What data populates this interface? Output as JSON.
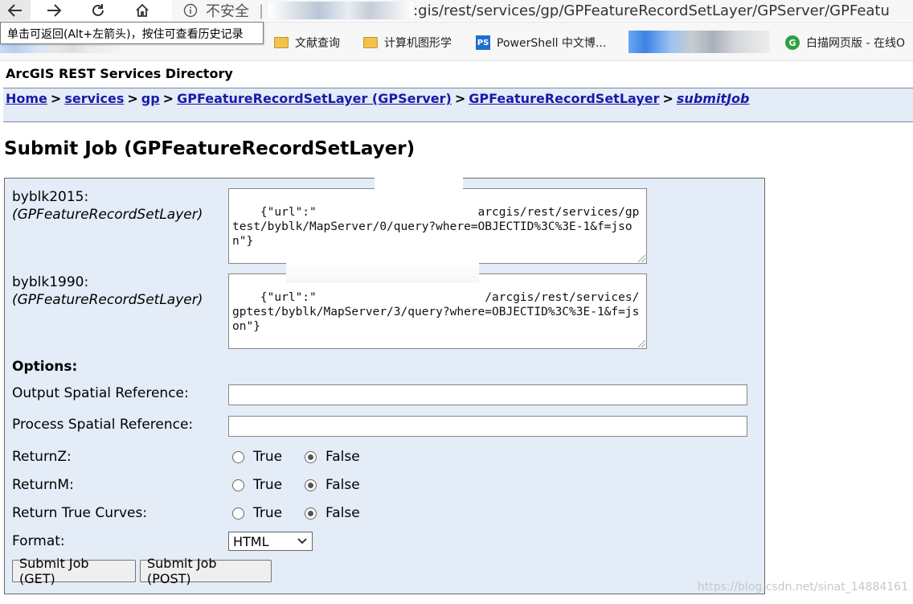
{
  "browser": {
    "insecure_label": "不安全",
    "address_separator": "|",
    "url": ":gis/rest/services/gp/GPFeatureRecordSetLayer/GPServer/GPFeatu",
    "tooltip": "单击可返回(Alt+左箭头)，按住可查看历史记录",
    "bookmarks": [
      {
        "label": "文献查询",
        "icon": "folder-icon"
      },
      {
        "label": "计算机图形学",
        "icon": "folder-icon"
      },
      {
        "label": "PowerShell 中文博...",
        "icon": "powershell-icon"
      },
      {
        "label": "白描网页版 - 在线O",
        "icon": "baimiao-icon"
      }
    ],
    "ps_icon_text": "PS",
    "baimiao_icon_text": "G"
  },
  "page": {
    "directory_title": "ArcGIS REST Services Directory",
    "breadcrumb": {
      "home": "Home",
      "services": "services",
      "gp": "gp",
      "gpserver": "GPFeatureRecordSetLayer (GPServer)",
      "task": "GPFeatureRecordSetLayer",
      "current": "submitJob",
      "separator": ">"
    },
    "heading": "Submit Job (GPFeatureRecordSetLayer)"
  },
  "form": {
    "param1": {
      "name": "byblk2015:",
      "type": "(GPFeatureRecordSetLayer)",
      "value": "{\"url\":\"                       arcgis/rest/services/gptest/byblk/MapServer/0/query?where=OBJECTID%3C%3E-1&f=json\"}"
    },
    "param2": {
      "name": "byblk1990:",
      "type": "(GPFeatureRecordSetLayer)",
      "value": "{\"url\":\"                        /arcgis/rest/services/gptest/byblk/MapServer/3/query?where=OBJECTID%3C%3E-1&f=json\"}"
    },
    "options_label": "Options:",
    "out_sr_label": "Output Spatial Reference:",
    "out_sr_value": "",
    "process_sr_label": "Process Spatial Reference:",
    "process_sr_value": "",
    "returnz_label": "ReturnZ:",
    "returnm_label": "ReturnM:",
    "return_curves_label": "Return True Curves:",
    "true_label": "True",
    "false_label": "False",
    "format_label": "Format:",
    "format_value": "HTML",
    "submit_get": "Submit Job (GET)",
    "submit_post": "Submit Job (POST)"
  },
  "watermark": "https://blog.csdn.net/sinat_14884161"
}
